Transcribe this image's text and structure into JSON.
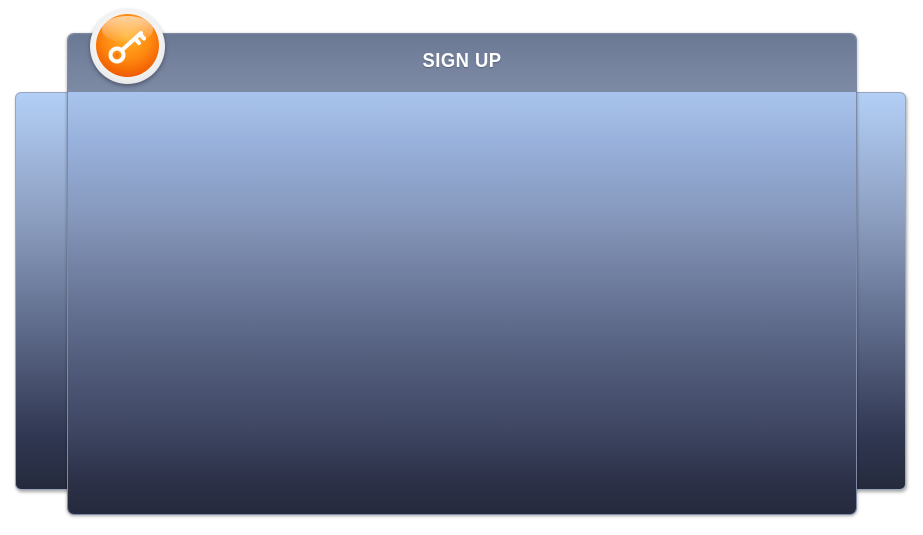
{
  "dialog": {
    "title": "SIGN UP",
    "icon": "key-icon",
    "colors": {
      "header": "#76839e",
      "body_top": "#a9c4ec",
      "body_bottom": "#262a3d",
      "badge": "#ff8a10"
    }
  }
}
